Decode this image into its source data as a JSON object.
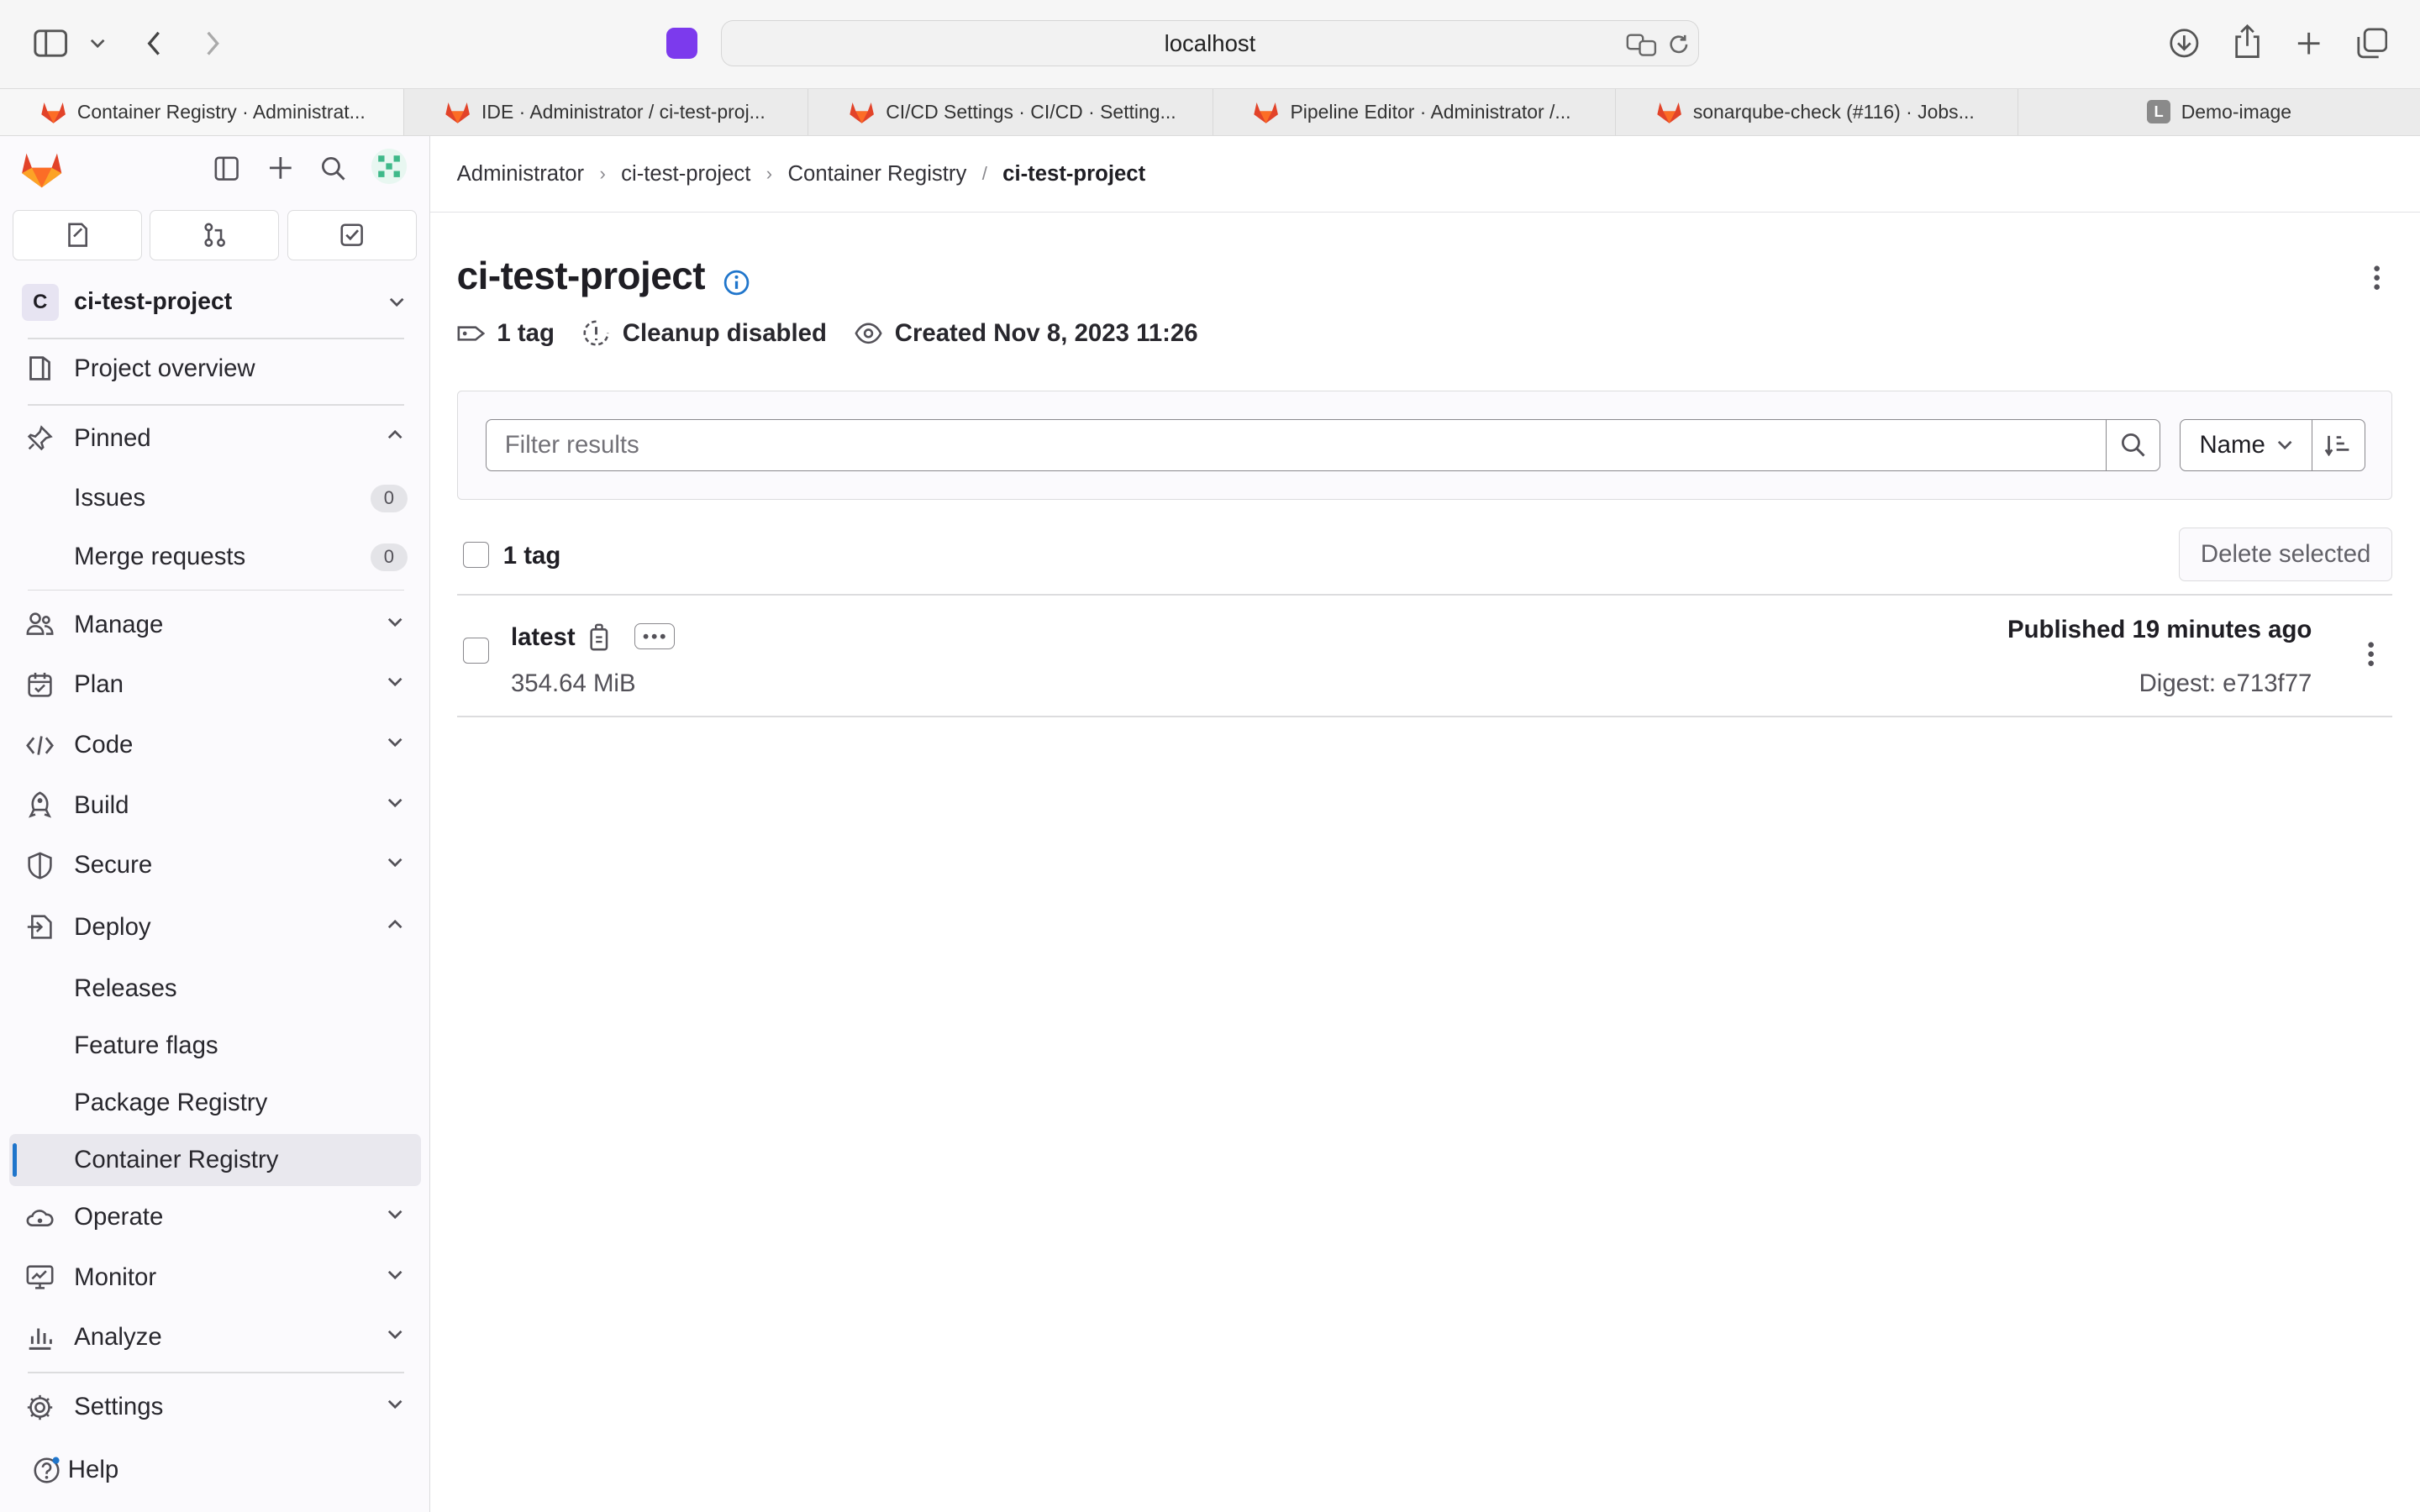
{
  "browser": {
    "url": "localhost",
    "tabs": [
      {
        "title": "Container Registry · Administrat...",
        "favicon": "gitlab-icon",
        "active": true
      },
      {
        "title": "IDE · Administrator / ci-test-proj...",
        "favicon": "gitlab-icon",
        "active": false
      },
      {
        "title": "CI/CD Settings · CI/CD · Setting...",
        "favicon": "gitlab-icon",
        "active": false
      },
      {
        "title": "Pipeline Editor · Administrator /...",
        "favicon": "gitlab-icon",
        "active": false
      },
      {
        "title": "sonarqube-check (#116) · Jobs...",
        "favicon": "gitlab-icon",
        "active": false
      },
      {
        "title": "Demo-image",
        "favicon": "L",
        "active": false
      }
    ]
  },
  "sidebar": {
    "project_avatar": "C",
    "project_name": "ci-test-project",
    "overview": "Project overview",
    "pinned": "Pinned",
    "pinned_items": [
      {
        "label": "Issues",
        "count": "0"
      },
      {
        "label": "Merge requests",
        "count": "0"
      }
    ],
    "sections": {
      "manage": "Manage",
      "plan": "Plan",
      "code": "Code",
      "build": "Build",
      "secure": "Secure",
      "deploy": "Deploy",
      "operate": "Operate",
      "monitor": "Monitor",
      "analyze": "Analyze",
      "settings": "Settings"
    },
    "deploy_items": [
      "Releases",
      "Feature flags",
      "Package Registry",
      "Container Registry"
    ],
    "help": "Help",
    "accent_color": "#1f75cb"
  },
  "breadcrumb": [
    "Administrator",
    "ci-test-project",
    "Container Registry",
    "ci-test-project"
  ],
  "page": {
    "title": "ci-test-project",
    "tags_meta": "1 tag",
    "cleanup": "Cleanup disabled",
    "created": "Created Nov 8, 2023 11:26"
  },
  "filter": {
    "placeholder": "Filter results",
    "sort_label": "Name"
  },
  "list": {
    "count_label": "1 tag",
    "delete_label": "Delete selected",
    "rows": [
      {
        "name": "latest",
        "size": "354.64 MiB",
        "published": "Published 19 minutes ago",
        "digest": "Digest: e713f77"
      }
    ]
  }
}
